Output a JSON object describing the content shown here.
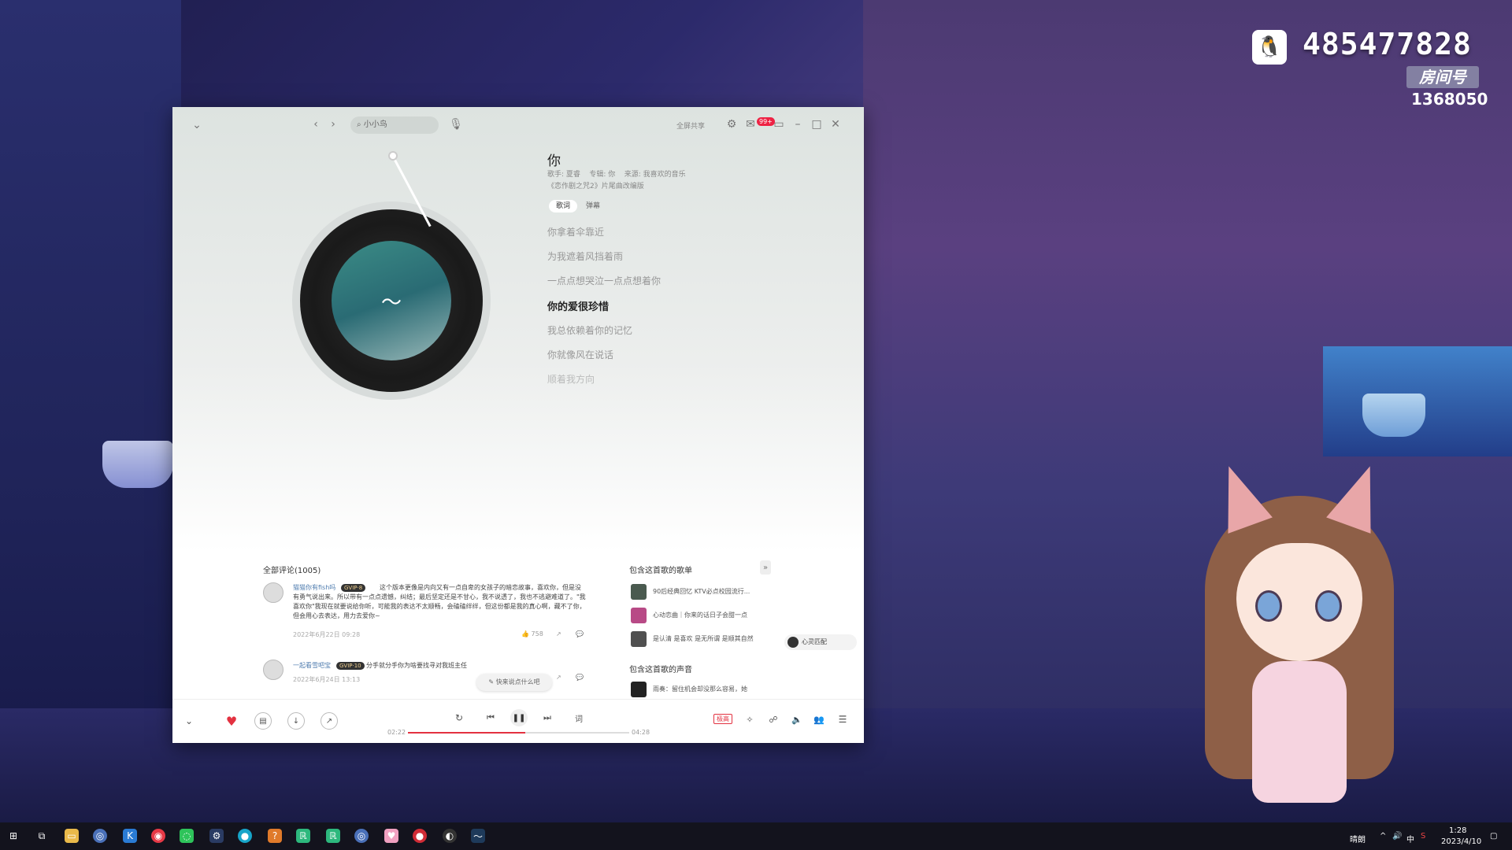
{
  "overlay": {
    "qq_number": "485477828",
    "room_label": "房间号",
    "room_number": "1368050"
  },
  "app": {
    "search_placeholder": "小小鸟",
    "topbar_share": "全屏共享",
    "mail_badge": "99+",
    "song": {
      "title": "你",
      "singer": "歌手: 夏睿",
      "album": "专辑: 你",
      "source": "来源: 我喜欢的音乐",
      "subline": "《恋作剧之咒2》片尾曲改编版"
    },
    "tabs": [
      "歌词",
      "弹幕"
    ],
    "lyrics": [
      "你拿着伞靠近",
      "为我遮着风挡着雨",
      "一点点想哭泣一点点想着你",
      "你的爱很珍惜",
      "我总依赖着你的记忆",
      "你就像风在说话",
      "顺着我方向"
    ],
    "comments": {
      "header": "全部评论(1005)",
      "items": [
        {
          "user": "猫猫你有fish吗",
          "vip": "GVIP·8",
          "text": "这个版本更像是内向又有一点自卑的女孩子的暗恋故事，喜欢你，但是没有勇气说出来。所以带有一点点遗憾，纠结；最后坚定还是不甘心，我不说透了，我也不逃避难道了。\"我喜欢你\"我现在就要说给你听，可能我的表达不太顺畅，会磕磕绊绊，但这份都是我的真心啊，藏不了你，但会用心去表达，用力去爱你~",
          "time": "2022年6月22日 09:28",
          "likes": "758"
        },
        {
          "user": "一起看雪吧宝",
          "vip": "GVIP·10",
          "text": "分手就分手你为啥要找寻对我班主任",
          "time": "2022年6月24日 13:13"
        }
      ],
      "float_button": "快来说点什么吧"
    },
    "playlists": {
      "header": "包含这首歌的歌单",
      "items": [
        "90后经典回忆 KTV必点校园流行...",
        "心动恋曲｜你来的话日子会甜一点",
        "是认清 是喜欢 是无所谓 是顺其自然"
      ],
      "match_pill": "心灵匹配"
    },
    "voices": {
      "header": "包含这首歌的声音",
      "items": [
        "雨奏：留住机会却没那么容易，她"
      ]
    },
    "player": {
      "current_time": "02:22",
      "total_time": "04:28",
      "progress_fraction": 0.53,
      "quality": "极高"
    }
  },
  "taskbar": {
    "weather": "晴朗",
    "lang": "中",
    "time": "1:28",
    "date": "2023/4/10"
  },
  "colors": {
    "accent": "#e33140"
  }
}
